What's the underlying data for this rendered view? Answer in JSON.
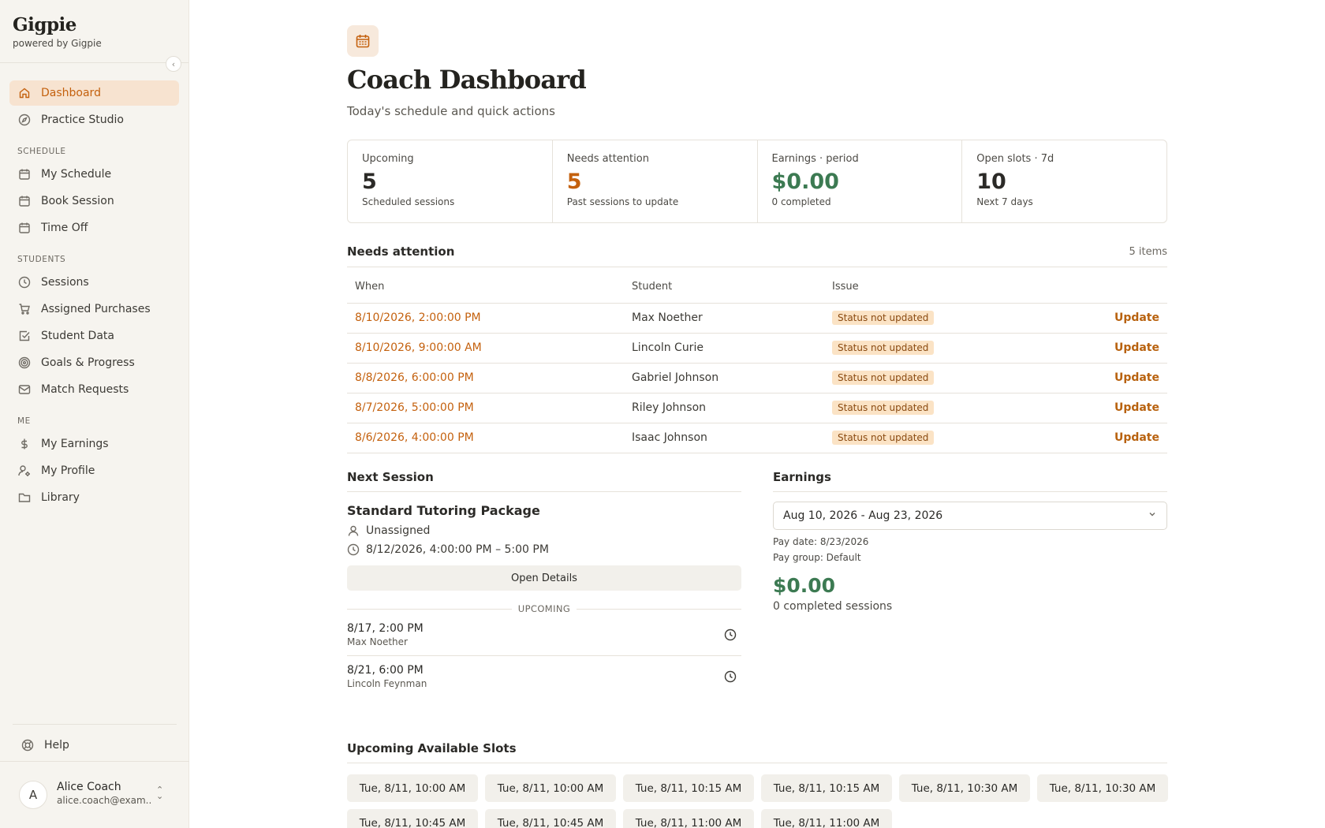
{
  "brand": {
    "name": "Gigpie",
    "sub": "powered by Gigpie"
  },
  "sidebar": {
    "top_items": [
      {
        "label": "Dashboard",
        "icon": "home-icon",
        "active": true
      },
      {
        "label": "Practice Studio",
        "icon": "compass-icon",
        "active": false
      }
    ],
    "sections": [
      {
        "label": "SCHEDULE",
        "items": [
          {
            "label": "My Schedule",
            "icon": "calendar-icon"
          },
          {
            "label": "Book Session",
            "icon": "calendar-icon"
          },
          {
            "label": "Time Off",
            "icon": "calendar-icon"
          }
        ]
      },
      {
        "label": "STUDENTS",
        "items": [
          {
            "label": "Sessions",
            "icon": "clock-icon"
          },
          {
            "label": "Assigned Purchases",
            "icon": "cart-icon"
          },
          {
            "label": "Student Data",
            "icon": "checkbox-icon"
          },
          {
            "label": "Goals & Progress",
            "icon": "target-icon"
          },
          {
            "label": "Match Requests",
            "icon": "mail-icon"
          }
        ]
      },
      {
        "label": "ME",
        "items": [
          {
            "label": "My Earnings",
            "icon": "dollar-icon"
          },
          {
            "label": "My Profile",
            "icon": "user-settings-icon"
          },
          {
            "label": "Library",
            "icon": "folder-icon"
          }
        ]
      }
    ],
    "help": "Help",
    "user": {
      "initial": "A",
      "name": "Alice Coach",
      "email": "alice.coach@exam..."
    }
  },
  "header": {
    "title": "Coach Dashboard",
    "subtitle": "Today's schedule and quick actions"
  },
  "stats": [
    {
      "label": "Upcoming",
      "value": "5",
      "note": "Scheduled sessions",
      "tone": "default"
    },
    {
      "label": "Needs attention",
      "value": "5",
      "note": "Past sessions to update",
      "tone": "orange"
    },
    {
      "label": "Earnings · period",
      "value": "$0.00",
      "note": "0 completed",
      "tone": "green"
    },
    {
      "label": "Open slots · 7d",
      "value": "10",
      "note": "Next 7 days",
      "tone": "default"
    }
  ],
  "attention": {
    "title": "Needs attention",
    "count": "5 items",
    "columns": [
      "When",
      "Student",
      "Issue"
    ],
    "rows": [
      {
        "when": "8/10/2026, 2:00:00 PM",
        "student": "Max Noether",
        "issue": "Status not updated",
        "action": "Update"
      },
      {
        "when": "8/10/2026, 9:00:00 AM",
        "student": "Lincoln Curie",
        "issue": "Status not updated",
        "action": "Update"
      },
      {
        "when": "8/8/2026, 6:00:00 PM",
        "student": "Gabriel Johnson",
        "issue": "Status not updated",
        "action": "Update"
      },
      {
        "when": "8/7/2026, 5:00:00 PM",
        "student": "Riley Johnson",
        "issue": "Status not updated",
        "action": "Update"
      },
      {
        "when": "8/6/2026, 4:00:00 PM",
        "student": "Isaac Johnson",
        "issue": "Status not updated",
        "action": "Update"
      }
    ]
  },
  "next_session": {
    "title": "Next Session",
    "package": "Standard Tutoring Package",
    "assignee": "Unassigned",
    "time": "8/12/2026, 4:00:00 PM – 5:00 PM",
    "open_label": "Open Details",
    "upcoming_label": "UPCOMING",
    "upcoming": [
      {
        "time": "8/17, 2:00 PM",
        "name": "Max Noether"
      },
      {
        "time": "8/21, 6:00 PM",
        "name": "Lincoln Feynman"
      }
    ]
  },
  "earnings": {
    "title": "Earnings",
    "range": "Aug 10, 2026 - Aug 23, 2026",
    "pay_date": "Pay date: 8/23/2026",
    "pay_group": "Pay group: Default",
    "amount": "$0.00",
    "note": "0 completed sessions"
  },
  "slots": {
    "title": "Upcoming Available Slots",
    "items": [
      "Tue, 8/11, 10:00 AM",
      "Tue, 8/11, 10:00 AM",
      "Tue, 8/11, 10:15 AM",
      "Tue, 8/11, 10:15 AM",
      "Tue, 8/11, 10:30 AM",
      "Tue, 8/11, 10:30 AM",
      "Tue, 8/11, 10:45 AM",
      "Tue, 8/11, 10:45 AM",
      "Tue, 8/11, 11:00 AM",
      "Tue, 8/11, 11:00 AM"
    ]
  },
  "colors": {
    "accent": "#c4610e",
    "green": "#3c7a52",
    "sidebar_bg": "#f6f4ef",
    "badge_bg": "#fbe3c5"
  }
}
